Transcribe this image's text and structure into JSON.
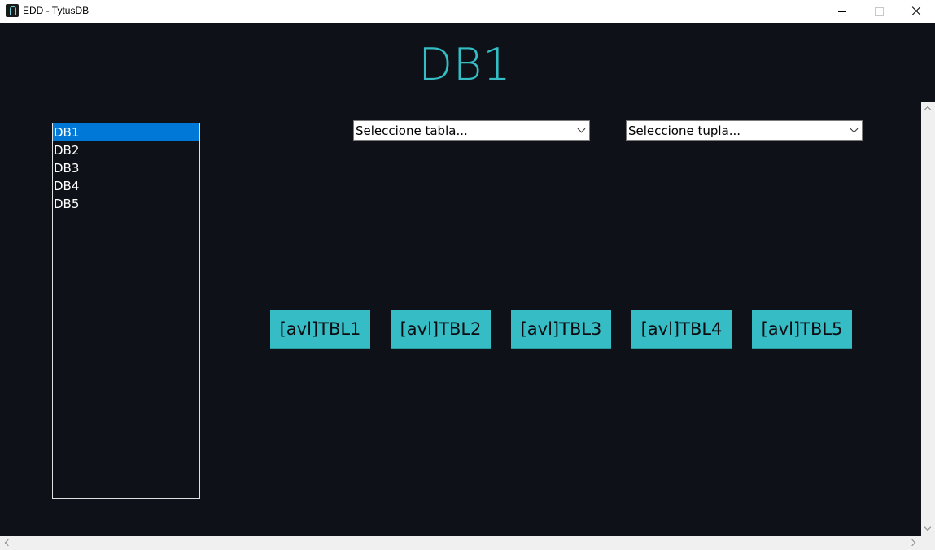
{
  "window": {
    "title": "EDD - TytusDB"
  },
  "main": {
    "heading": "DB1",
    "databases": [
      "DB1",
      "DB2",
      "DB3",
      "DB4",
      "DB5"
    ],
    "selected_database": "DB1",
    "table_select": {
      "value": "Seleccione tabla..."
    },
    "tuple_select": {
      "value": "Seleccione tupla..."
    },
    "tables": [
      "[avl]TBL1",
      "[avl]TBL2",
      "[avl]TBL3",
      "[avl]TBL4",
      "[avl]TBL5"
    ]
  },
  "colors": {
    "background": "#0e1117",
    "accent": "#36bcc4",
    "selection": "#0078d7"
  }
}
